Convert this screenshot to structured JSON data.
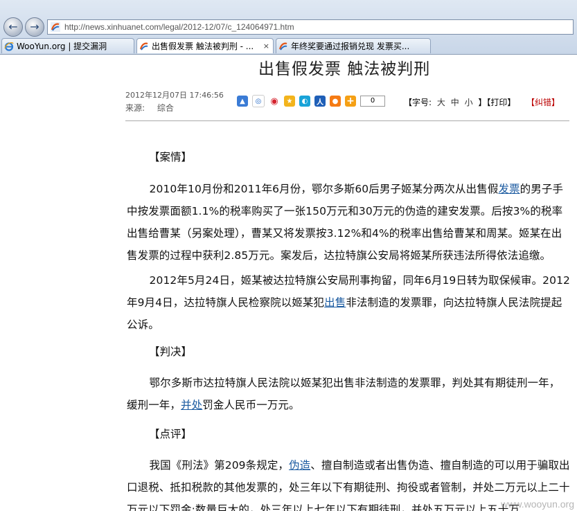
{
  "browser": {
    "url": "http://news.xinhuanet.com/legal/2012-12/07/c_124064971.htm",
    "tabs": [
      {
        "label": "WooYun.org | 提交漏洞",
        "active": false
      },
      {
        "label": "出售假发票 触法被判刑 - ...",
        "active": true
      },
      {
        "label": "年终奖要通过报销兑现 发票买...",
        "active": false
      }
    ],
    "tab_close": "×"
  },
  "article": {
    "title": "出售假发票  触法被判刑",
    "date": "2012年12月07日 17:46:56",
    "source_label": "来源:",
    "source_value": "综合",
    "share_count": "0",
    "fontsize_label": "【字号:",
    "fontsize_options": [
      "大",
      "中",
      "小"
    ],
    "print_label": "】【打印】",
    "correct_label": "【纠错】",
    "sections": {
      "case_heading": "【案情】",
      "p1_a": "2010年10月份和2011年6月份，鄂尔多斯60后男子姬某分两次从出售假",
      "p1_link": "发票",
      "p1_b": "的男子手中按发票面额1.1%的税率购买了一张150万元和30万元的伪造的建安发票。后按3%的税率出售给曹某（另案处理），曹某又将发票按3.12%和4%的税率出售给曹某和周某。姬某在出售发票的过程中获利2.85万元。案发后，达拉特旗公安局将姬某所获违法所得依法追缴。",
      "p2_a": "2012年5月24日，姬某被达拉特旗公安局刑事拘留，同年6月19日转为取保候审。2012年9月4日，达拉特旗人民检察院以姬某犯",
      "p2_link": "出售",
      "p2_b": "非法制造的发票罪，向达拉特旗人民法院提起公诉。",
      "verdict_heading": "【判决】",
      "p3_a": "鄂尔多斯市达拉特旗人民法院以姬某犯出售非法制造的发票罪，判处其有期徒刑一年，缓刑一年，",
      "p3_link": "并处",
      "p3_b": "罚金人民币一万元。",
      "comment_heading": "【点评】",
      "p4_a": "我国《刑法》第209条规定，",
      "p4_link": "伪造",
      "p4_b": "、擅自制造或者出售伪造、擅自制造的可以用于骗取出口退税、抵扣税款的其他发票的，处三年以下有期徒刑、拘役或者管制，并处二万元以上二十万元以下罚金;数量巨大的，处三年以上七年以下有期徒刑，并处五万元以上五十万"
    }
  },
  "watermark": "www.wooyun.org",
  "colors": {
    "link": "#1a5aa0",
    "correct": "#bb0000"
  },
  "share_icons": [
    "share-icon-1",
    "share-icon-2",
    "weibo-icon",
    "share-icon-4",
    "share-icon-5",
    "renren-icon",
    "share-icon-7",
    "plus-icon"
  ]
}
